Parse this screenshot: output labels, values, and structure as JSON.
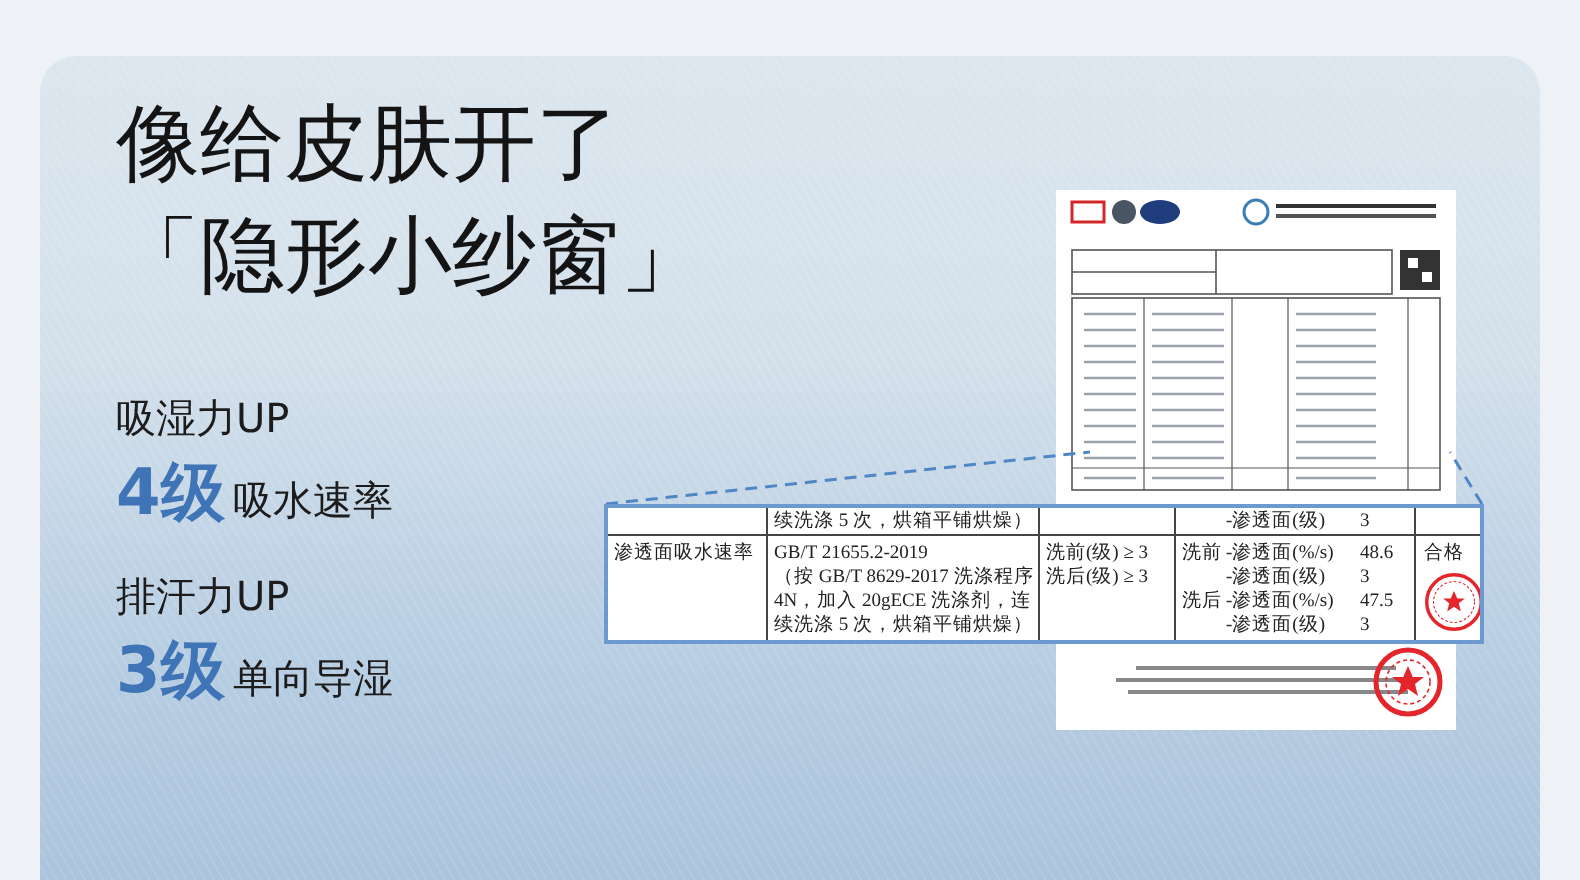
{
  "headline": {
    "line_1": "像给皮肤开了",
    "line_2": "「隐形小纱窗」"
  },
  "features": [
    {
      "title": "吸湿力UP",
      "grade": "4级",
      "caption": "吸水速率"
    },
    {
      "title": "排汗力UP",
      "grade": "3级",
      "caption": "单向导湿"
    }
  ],
  "report_excerpt": {
    "top_row": {
      "method": "续洗涤 5 次，烘箱平铺烘燥）",
      "label": "-渗透面(级)",
      "value": "3"
    },
    "row": {
      "item": "渗透面吸水速率",
      "method": [
        "GB/T 21655.2-2019",
        "（按 GB/T 8629-2017 洗涤程序",
        "4N，加入 20gECE 洗涤剂，连",
        "续洗涤 5 次，烘箱平铺烘燥）"
      ],
      "requirements": [
        "洗前(级) ≥ 3",
        "洗后(级) ≥ 3"
      ],
      "results": [
        {
          "stage": "洗前",
          "label": "-渗透面(%/s)",
          "value": "48.6"
        },
        {
          "label": "-渗透面(级)",
          "value": "3"
        },
        {
          "stage": "洗后",
          "label": "-渗透面(%/s)",
          "value": "47.5"
        },
        {
          "label": "-渗透面(级)",
          "value": "3"
        }
      ],
      "verdict": "合格"
    }
  }
}
